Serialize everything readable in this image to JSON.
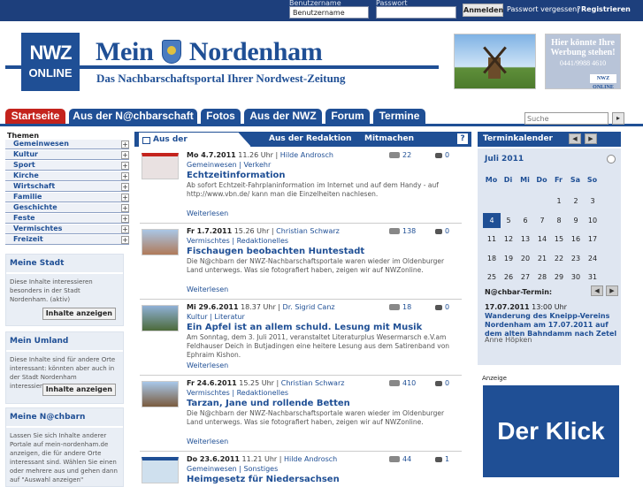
{
  "topbar": {
    "username_label": "Benutzername",
    "username_value": "Benutzername",
    "password_label": "Passwort",
    "password_value": "",
    "login_button": "Anmelden",
    "forgot_link": "Passwort vergessen?",
    "separator": "|",
    "register_link": "Registrieren"
  },
  "header": {
    "logo_line1": "NWZ",
    "logo_line2": "ONLINE",
    "title_part1": "Mein",
    "title_part2": "Nordenham",
    "subtitle": "Das Nachbarschaftsportal Ihrer Nordwest-Zeitung",
    "ad_line1": "Hier könnte Ihre",
    "ad_line2": "Werbung stehen!",
    "ad_phone": "0441/9988 4610",
    "ad_logo": "NWZ ONLINE"
  },
  "nav": {
    "tabs": [
      "Startseite",
      "Aus der N@chbarschaft",
      "Fotos",
      "Aus der NWZ",
      "Forum",
      "Termine"
    ],
    "search_placeholder": "Suche",
    "search_button": "▸"
  },
  "left": {
    "themes_title": "Themen",
    "themes": [
      "Gemeinwesen",
      "Kultur",
      "Sport",
      "Kirche",
      "Wirtschaft",
      "Familie",
      "Geschichte",
      "Feste",
      "Vermischtes",
      "Freizeit"
    ],
    "box_stadt": {
      "title": "Meine Stadt",
      "text": "Diese Inhalte interessieren besonders in der Stadt Nordenham. (aktiv)",
      "button": "Inhalte anzeigen"
    },
    "box_umland": {
      "title": "Mein Umland",
      "text": "Diese Inhalte sind für andere Orte interessant: könnten aber auch in der Stadt Nordenham interessieren.",
      "button": "Inhalte anzeigen"
    },
    "box_nachbarn": {
      "title": "Meine N@chbarn",
      "text": "Lassen Sie sich Inhalte anderer Portale auf mein-nordenham.de anzeigen, die für andere Orte interessant sind. Wählen Sie einen oder mehrere aus und gehen dann auf \"Auswahl anzeigen\""
    }
  },
  "main": {
    "tabs": [
      "Aus der N@chbarschaft",
      "Aus der Redaktion",
      "Mitmachen"
    ],
    "help": "?",
    "more_label": "Weiterlesen",
    "articles": [
      {
        "date": "Mo 4.7.2011",
        "time": "11.26 Uhr |",
        "author": "Hilde Androsch",
        "cats": "Gemeinwesen | Verkehr",
        "title": "Echtzeitinformation",
        "text": "Ab sofort Echtzeit-Fahrplaninformation im Internet und auf dem Handy - auf http://www.vbn.de/ kann man die Einzelheiten nachlesen.",
        "views": "22",
        "comments": "0"
      },
      {
        "date": "Fr 1.7.2011",
        "time": "15.26 Uhr |",
        "author": "Christian Schwarz",
        "cats": "Vermischtes | Redaktionelles",
        "title": "Fischaugen beobachten Huntestadt",
        "text": "Die N@chbarn der NWZ-Nachbarschaftsportale waren wieder im Oldenburger Land unterwegs. Was sie fotografiert haben, zeigen wir auf NWZonline.",
        "views": "138",
        "comments": "0"
      },
      {
        "date": "Mi 29.6.2011",
        "time": "18.37 Uhr |",
        "author": "Dr. Sigrid Canz",
        "cats": "Kultur | Literatur",
        "title": "Ein Apfel ist an allem schuld. Lesung mit Musik",
        "text": "Am Sonntag, dem 3. Juli 2011, veranstaltet Literaturplus Wesermarsch e.V.am Feldhauser Deich in Butjadingen eine heitere Lesung aus dem Satirenband von Ephraim Kishon.",
        "views": "18",
        "comments": "0"
      },
      {
        "date": "Fr 24.6.2011",
        "time": "15.25 Uhr |",
        "author": "Christian Schwarz",
        "cats": "Vermischtes | Redaktionelles",
        "title": "Tarzan, Jane und rollende Betten",
        "text": "Die N@chbarn der NWZ-Nachbarschaftsportale waren wieder im Oldenburger Land unterwegs. Was sie fotografiert haben, zeigen wir auf NWZonline.",
        "views": "410",
        "comments": "0"
      },
      {
        "date": "Do 23.6.2011",
        "time": "11.21 Uhr |",
        "author": "Hilde Androsch",
        "cats": "Gemeinwesen | Sonstiges",
        "title": "Heimgesetz für Niedersachsen",
        "text": "",
        "views": "44",
        "comments": "1"
      }
    ]
  },
  "right": {
    "calendar_title": "Terminkalender",
    "month": "Juli 2011",
    "day_names": [
      "Mo",
      "Di",
      "Mi",
      "Do",
      "Fr",
      "Sa",
      "So"
    ],
    "weeks": [
      [
        "",
        "",
        "",
        "",
        "1",
        "2",
        "3"
      ],
      [
        "4",
        "5",
        "6",
        "7",
        "8",
        "9",
        "10"
      ],
      [
        "11",
        "12",
        "13",
        "14",
        "15",
        "16",
        "17"
      ],
      [
        "18",
        "19",
        "20",
        "21",
        "22",
        "23",
        "24"
      ],
      [
        "25",
        "26",
        "27",
        "28",
        "29",
        "30",
        "31"
      ]
    ],
    "today": "4",
    "next_label": "N@chbar-Termin:",
    "next_date": "17.07.2011",
    "next_time": "13:00 Uhr",
    "next_title": "Wanderung des Kneipp-Vereins Nordenham am 17.07.2011 auf dem alten Bahndamm nach Zetel",
    "next_author": "Anne Höpken",
    "ad_label": "Anzeige",
    "ad_text": "Der Klick"
  },
  "colors": {
    "primary": "#1f4f95",
    "active_tab": "#c4231d",
    "panel_bg": "#dfe6f1"
  }
}
